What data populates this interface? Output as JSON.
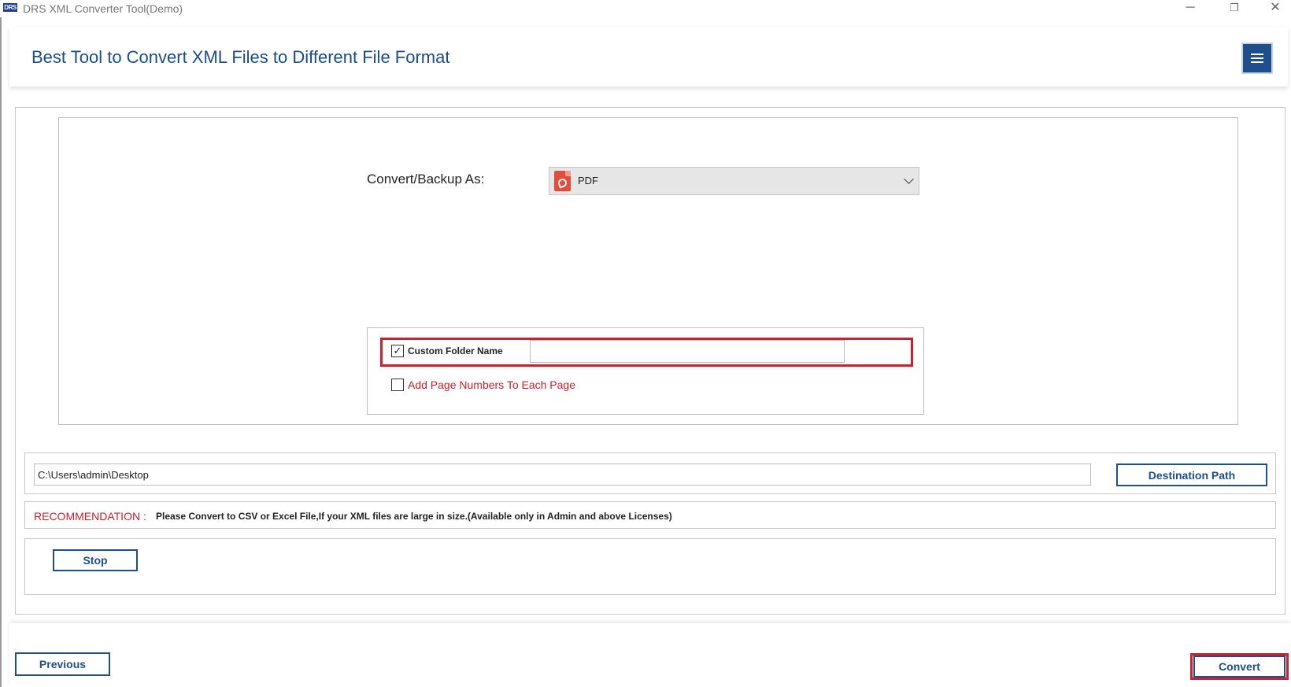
{
  "window": {
    "app_icon_text": "DRS",
    "title": "DRS XML Converter Tool(Demo)",
    "minimize_glyph": "─",
    "restore_glyph": "❐",
    "close_glyph": "✕"
  },
  "header": {
    "title": "Best Tool to Convert XML Files to Different File Format",
    "menu_icon": "hamburger-menu-icon"
  },
  "options": {
    "convert_label": "Convert/Backup As:",
    "format_selected": "PDF",
    "format_icon": "pdf-file-icon",
    "custom_folder": {
      "label": "Custom Folder Name",
      "checked": true,
      "checkmark": "✓",
      "value": ""
    },
    "page_numbers": {
      "label": "Add Page Numbers To Each Page",
      "checked": false
    }
  },
  "destination": {
    "path": "C:\\Users\\admin\\Desktop",
    "button_label": "Destination Path"
  },
  "recommendation": {
    "label": "RECOMMENDATION :",
    "text": "Please Convert to CSV or Excel File,If your XML files are large in size.(Available only in Admin and above Licenses)"
  },
  "actions": {
    "stop_label": "Stop",
    "previous_label": "Previous",
    "convert_label": "Convert"
  },
  "colors": {
    "accent_blue": "#1f4e8c",
    "highlight_red": "#d01f2b"
  }
}
